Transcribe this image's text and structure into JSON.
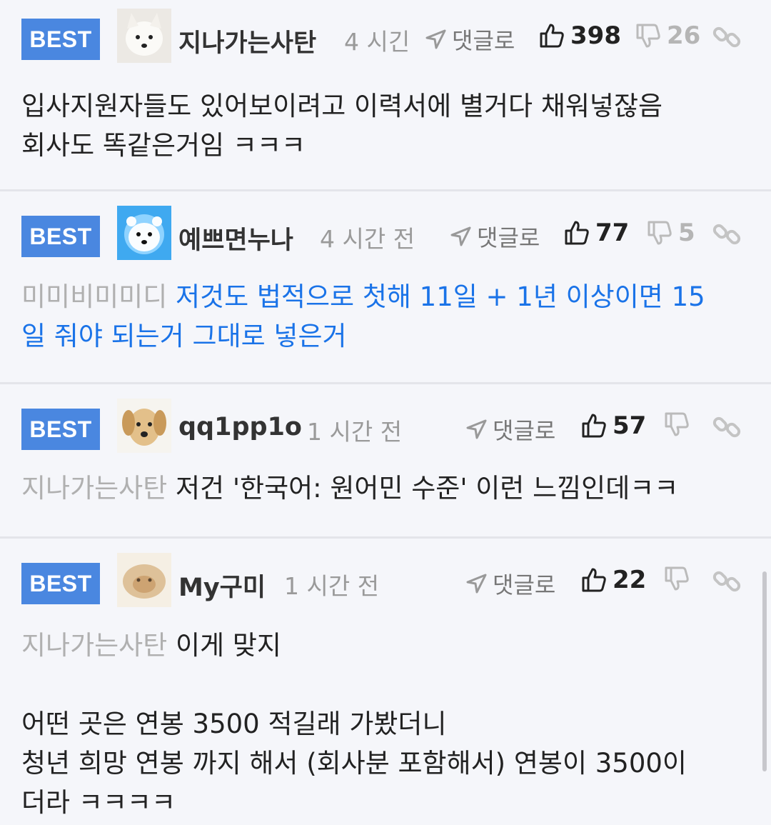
{
  "comments": [
    {
      "badge": "BEST",
      "nickname": "지나가는사탄",
      "time": "4 시긴",
      "reply_label": "댓글로",
      "likes": "398",
      "dislikes": "26",
      "body_lines": [
        "입사지원자들도 있어보이려고 이력서에 별거다 채워넣잖음",
        "회사도 똑같은거임 ㅋㅋㅋ"
      ]
    },
    {
      "badge": "BEST",
      "nickname": "예쁘면누나",
      "time": "4 시간 전",
      "reply_label": "댓글로",
      "likes": "77",
      "dislikes": "5",
      "mention": "미미비미미디",
      "body_first": " 저것도 법적으로 첫해 11일 + 1년 이상이면 15",
      "body_second": "일 줘야 되는거 그대로 넣은거"
    },
    {
      "badge": "BEST",
      "nickname": "qq1pp1o",
      "time": "1 시간 전",
      "reply_label": "댓글로",
      "likes": "57",
      "mention": "지나가는사탄",
      "body": " 저건 '한국어: 원어민 수준' 이런 느낌인데ㅋㅋ"
    },
    {
      "badge": "BEST",
      "nickname": "My구미",
      "time": "1 시간 전",
      "reply_label": "댓글로",
      "likes": "22",
      "mention": "지나가는사탄",
      "body_first": " 이게 맞지",
      "body_lines": [
        "어떤 곳은 연봉 3500 적길래 가봤더니",
        "청년 희망 연봉 까지 해서 (회사분 포함해서) 연봉이 3500이",
        "더라 ㅋㅋㅋㅋ"
      ]
    }
  ],
  "colors": {
    "badge": "#4a87e0",
    "link_text": "#1a73e8",
    "mention": "#b0b0b0",
    "background": "#f5f6fa"
  },
  "icons": [
    "reply-arrow-icon",
    "thumbs-up-icon",
    "thumbs-down-icon",
    "link-icon"
  ]
}
